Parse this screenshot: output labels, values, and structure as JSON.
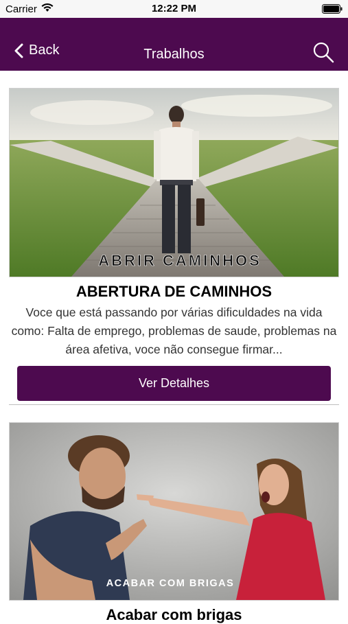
{
  "status_bar": {
    "carrier": "Carrier",
    "time": "12:22 PM"
  },
  "nav": {
    "back_label": "Back",
    "title": "Trabalhos"
  },
  "cards": [
    {
      "image_caption": "ABRIR CAMINHOS",
      "title": "ABERTURA DE CAMINHOS",
      "description": "Voce que está passando por várias dificuldades na vida como: Falta de emprego, problemas de saude, problemas na área afetiva, voce não consegue firmar...",
      "button_label": "Ver Detalhes"
    },
    {
      "image_caption": "ACABAR COM BRIGAS",
      "title": "Acabar com brigas"
    }
  ],
  "colors": {
    "accent": "#4d0a4f",
    "status_bar": "#f7f7f7"
  }
}
